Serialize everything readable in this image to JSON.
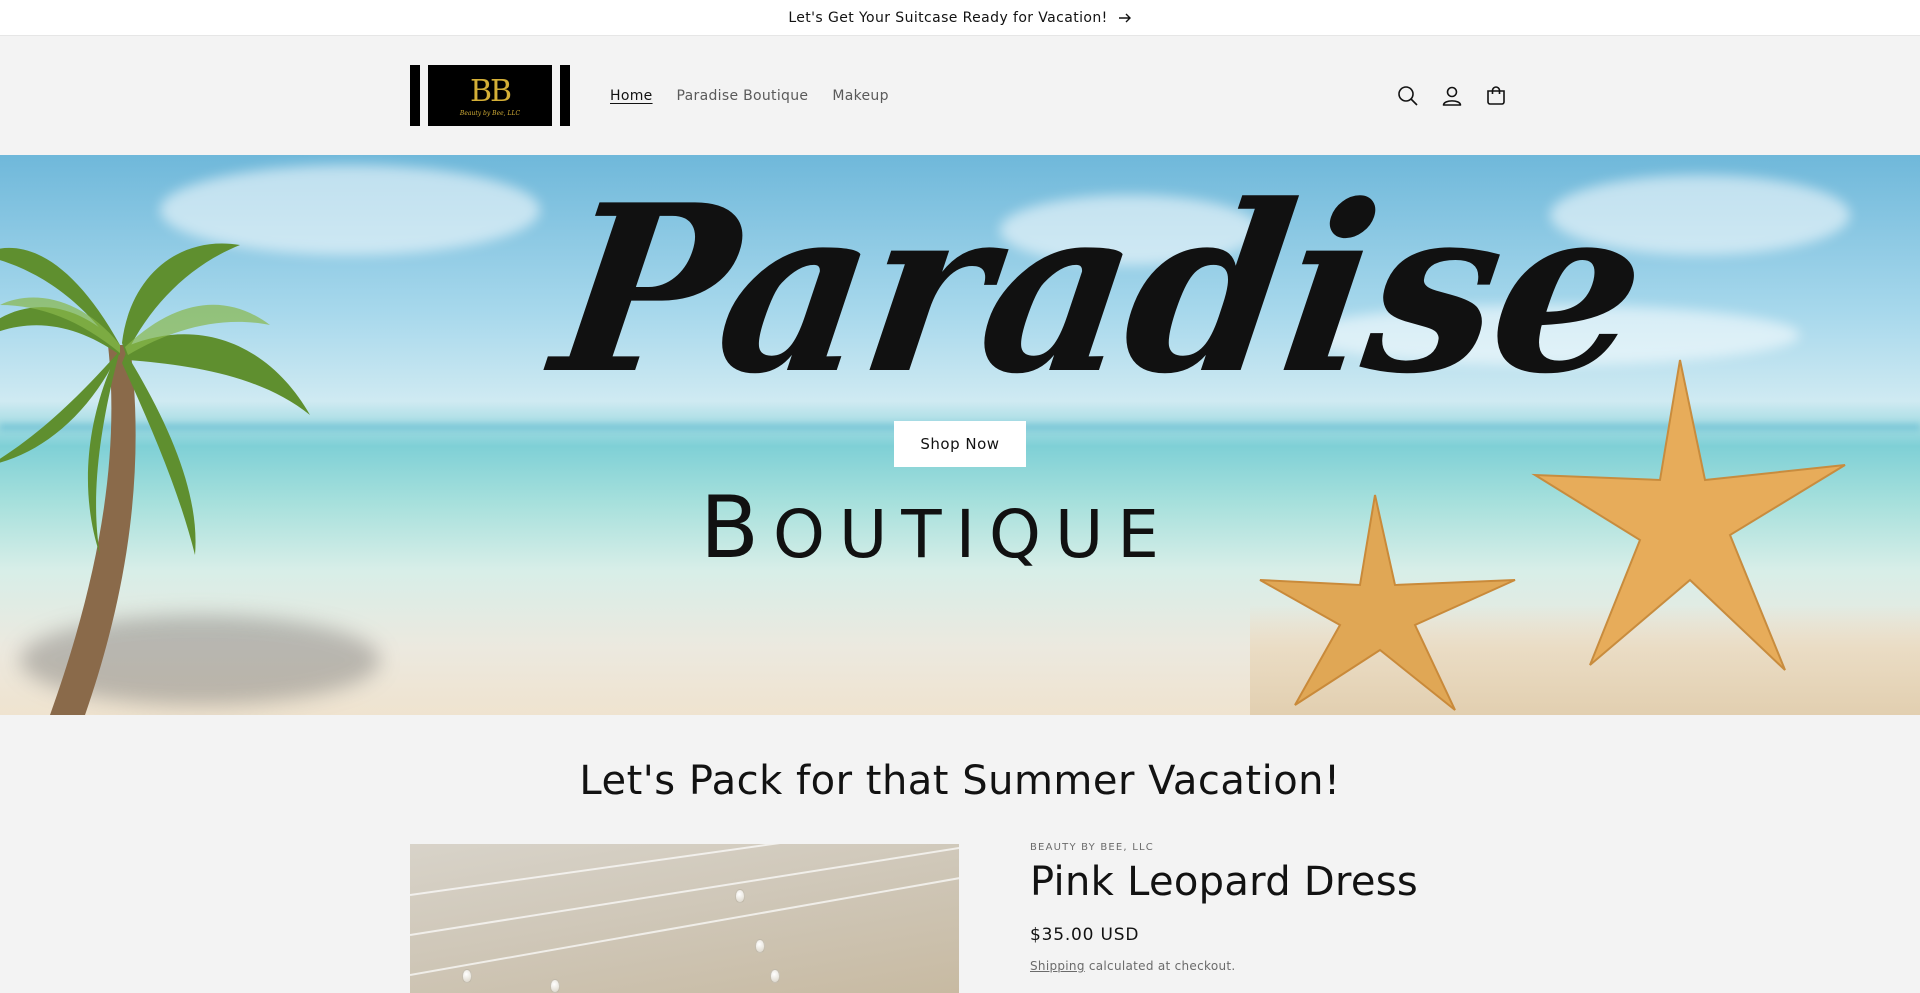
{
  "announcement": {
    "text": "Let's Get Your Suitcase Ready for Vacation!",
    "icon": "arrow-right-icon"
  },
  "header": {
    "logo": {
      "monogram": "BB",
      "tagline": "Beauty by Bee, LLC"
    },
    "nav": [
      {
        "label": "Home",
        "active": true
      },
      {
        "label": "Paradise Boutique",
        "active": false
      },
      {
        "label": "Makeup",
        "active": false
      }
    ],
    "icons": [
      "search-icon",
      "account-icon",
      "cart-icon"
    ]
  },
  "hero": {
    "title_script": "Paradise",
    "title_sub_big_first": "B",
    "title_sub_rest": "OUTIQUE",
    "button_label": "Shop Now"
  },
  "featured": {
    "section_title": "Let's Pack for that Summer Vacation!",
    "product": {
      "vendor": "BEAUTY BY BEE, LLC",
      "name": "Pink Leopard Dress",
      "price": "$35.00 USD",
      "shipping_link": "Shipping",
      "shipping_text": " calculated at checkout."
    }
  },
  "colors": {
    "accent": "#121212",
    "background": "#f3f3f3",
    "logo_gold": "#d4af37"
  }
}
